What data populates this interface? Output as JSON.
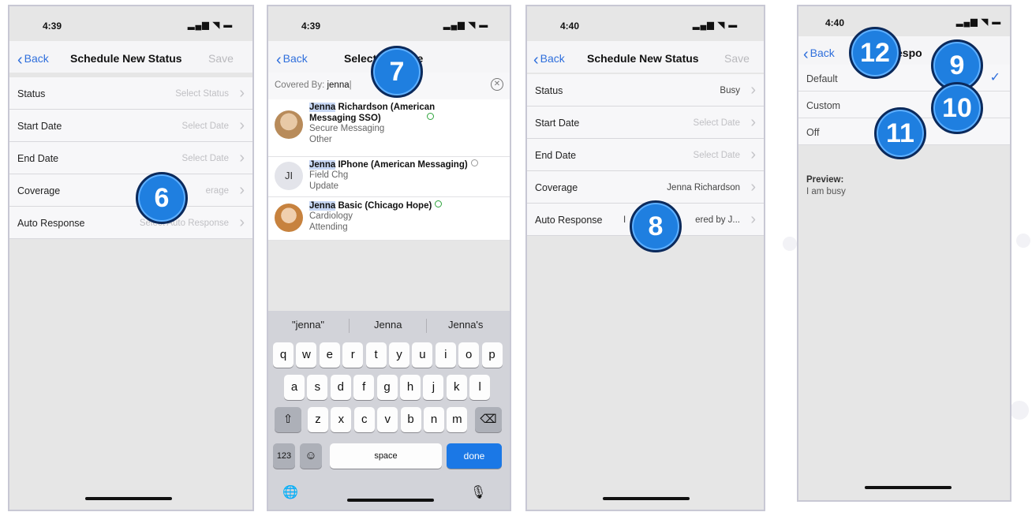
{
  "statusbar": {
    "time_a": "4:39",
    "time_b": "4:40",
    "person_glyph": "👤",
    "signal": "▂▄▆ ◥ ▬"
  },
  "screen1": {
    "back": "Back",
    "title": "Schedule New Status",
    "save": "Save",
    "rows": [
      {
        "label": "Status",
        "value": "Select Status"
      },
      {
        "label": "Start Date",
        "value": "Select Date"
      },
      {
        "label": "End Date",
        "value": "Select Date"
      },
      {
        "label": "Coverage",
        "value": "erage"
      },
      {
        "label": "Auto Response",
        "value": "Select Auto Response"
      }
    ],
    "badge": "6"
  },
  "screen2": {
    "back": "Back",
    "title": "Select",
    "title_tail": "ge",
    "covered_label": "Covered By:",
    "query": "jenna",
    "results": [
      {
        "name_hl": "Jenna",
        "name_rest": " Richardson (American",
        "name_line2": "Messaging SSO)",
        "sub1": "Secure Messaging",
        "sub2": "Other",
        "status": "green"
      },
      {
        "initials": "JI",
        "name_hl": "Jenna",
        "name_rest": " IPhone (American Messaging)",
        "sub1": "Field Chg",
        "sub2": "Update",
        "status": "gray"
      },
      {
        "name_hl": "Jenna",
        "name_rest": " Basic (Chicago Hope)",
        "sub1": "Cardiology",
        "sub2": "Attending",
        "status": "green"
      }
    ],
    "suggestions": [
      "\"jenna\"",
      "Jenna",
      "Jenna's"
    ],
    "keys_row1": [
      "q",
      "w",
      "e",
      "r",
      "t",
      "y",
      "u",
      "i",
      "o",
      "p"
    ],
    "keys_row2": [
      "a",
      "s",
      "d",
      "f",
      "g",
      "h",
      "j",
      "k",
      "l"
    ],
    "keys_row3": [
      "z",
      "x",
      "c",
      "v",
      "b",
      "n",
      "m"
    ],
    "key_shift": "⇧",
    "key_delete": "⌫",
    "key_123": "123",
    "key_emoji": "☺",
    "key_space": "space",
    "key_done": "done",
    "key_globe": "🌐",
    "key_mic": "🎙",
    "badge": "7"
  },
  "screen3": {
    "back": "Back",
    "title": "Schedule New Status",
    "save": "Save",
    "rows": [
      {
        "label": "Status",
        "value": "Busy"
      },
      {
        "label": "Start Date",
        "value": "Select Date"
      },
      {
        "label": "End Date",
        "value": "Select Date"
      },
      {
        "label": "Coverage",
        "value": "Jenna Richardson"
      },
      {
        "label": "Auto Response",
        "value_left": "I",
        "value": "ered by J..."
      }
    ],
    "badge": "8"
  },
  "screen4": {
    "back": "Back",
    "title_tail": "espo",
    "options": [
      {
        "label": "Default",
        "checked": true
      },
      {
        "label": "Custom"
      },
      {
        "label": "Off"
      }
    ],
    "check": "✓",
    "preview_label": "Preview:",
    "preview_text": "I am busy",
    "badges": [
      "12",
      "9",
      "10",
      "11"
    ]
  },
  "colors": {
    "accent": "#2f6fdc",
    "badge": "#1f7fe0",
    "badge_border": "#0b2a5c",
    "done_key": "#1b78e6"
  }
}
